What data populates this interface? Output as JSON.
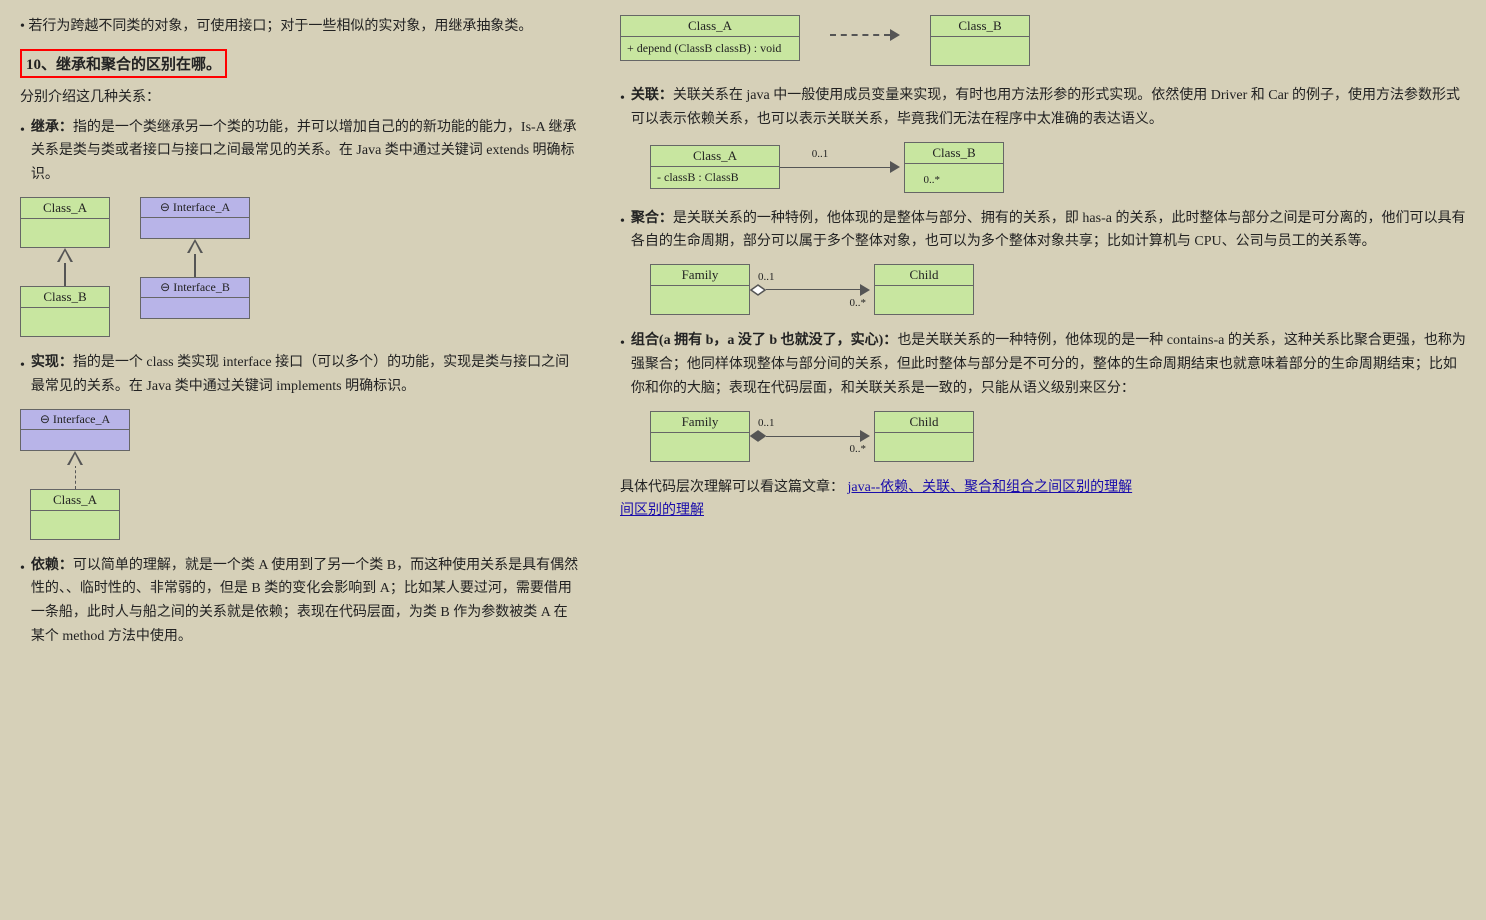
{
  "page": {
    "intro_bullet": "若行为跨越不同类的对象，可使用接口；对于一些相似的实对象，用继承抽象类。",
    "section10_heading": "10、继承和聚合的区别在哪。",
    "subsection_intro": "分别介绍这几种关系：",
    "bullets": [
      {
        "id": "inheritance",
        "label": "继承：",
        "text": "指的是一个类继承另一个类的功能，并可以增加自己的的新功能的能力，Is-A 继承关系是类与类或者接口与接口之间最常见的关系。在 Java 类中通过关键词 extends 明确标识。"
      },
      {
        "id": "implementation",
        "label": "实现：",
        "text": "指的是一个 class 类实现 interface 接口（可以多个）的功能，实现是类与接口之间最常见的关系。在 Java 类中通过关键词 implements 明确标识。"
      },
      {
        "id": "dependency",
        "label": "依赖：",
        "text": "可以简单的理解，就是一个类 A 使用到了另一个类 B，而这种使用关系是具有偶然性的、、临时性的、非常弱的，但是 B 类的变化会影响到 A；比如某人要过河，需要借用一条船，此时人与船之间的关系就是依赖；表现在代码层面，为类 B 作为参数被类 A 在某个 method 方法中使用。"
      }
    ],
    "right_bullets": [
      {
        "id": "association",
        "label": "关联：",
        "text": "关联关系在 java 中一般使用成员变量来实现，有时也用方法形参的形式实现。依然使用 Driver 和 Car 的例子，使用方法参数形式可以表示依赖关系，也可以表示关联关系，毕竟我们无法在程序中太准确的表达语义。"
      },
      {
        "id": "aggregation",
        "label": "聚合：",
        "text": "是关联关系的一种特例，他体现的是整体与部分、拥有的关系，即 has-a 的关系，此时整体与部分之间是可分离的，他们可以具有各自的生命周期，部分可以属于多个整体对象，也可以为多个整体对象共享；比如计算机与 CPU、公司与员工的关系等。"
      },
      {
        "id": "composition",
        "label": "组合(a 拥有 b，a 没了 b 也就没了，实心)：",
        "text": "也是关联关系的一种特例，他体现的是一种 contains-a 的关系，这种关系比聚合更强，也称为强聚合；他同样体现整体与部分间的关系，但此时整体与部分是不可分的，整体的生命周期结束也就意味着部分的生命周期结束；比如你和你的大脑；表现在代码层面，和关联关系是一致的，只能从语义级别来区分："
      }
    ],
    "bottom_text": "具体代码层次理解可以看这篇文章：",
    "bottom_link": "java--依赖、关联、聚合和组合之间区别的理解",
    "diagrams": {
      "top_right_dep": {
        "class_a": "Class_A",
        "class_b": "Class_B",
        "method": "+ depend (ClassB classB) : void"
      },
      "assoc": {
        "class_a": "Class_A",
        "class_b": "Class_B",
        "field": "- classB : ClassB",
        "mult_left": "0..1",
        "mult_right": "0..*"
      },
      "aggregation": {
        "class_a": "Family",
        "class_b": "Child",
        "mult_left": "0..1",
        "mult_right": "0..*"
      },
      "composition": {
        "class_a": "Family",
        "class_b": "Child",
        "mult_left": "0..1",
        "mult_right": "0..*"
      },
      "inheritance_left": {
        "class_a": "Class_A",
        "class_b": "Class_B"
      },
      "interface_left": {
        "interface_a": "Interface_A",
        "interface_b": "Interface_B"
      },
      "impl_diagram": {
        "interface_a": "Interface_A",
        "class_a": "Class_A"
      }
    }
  }
}
